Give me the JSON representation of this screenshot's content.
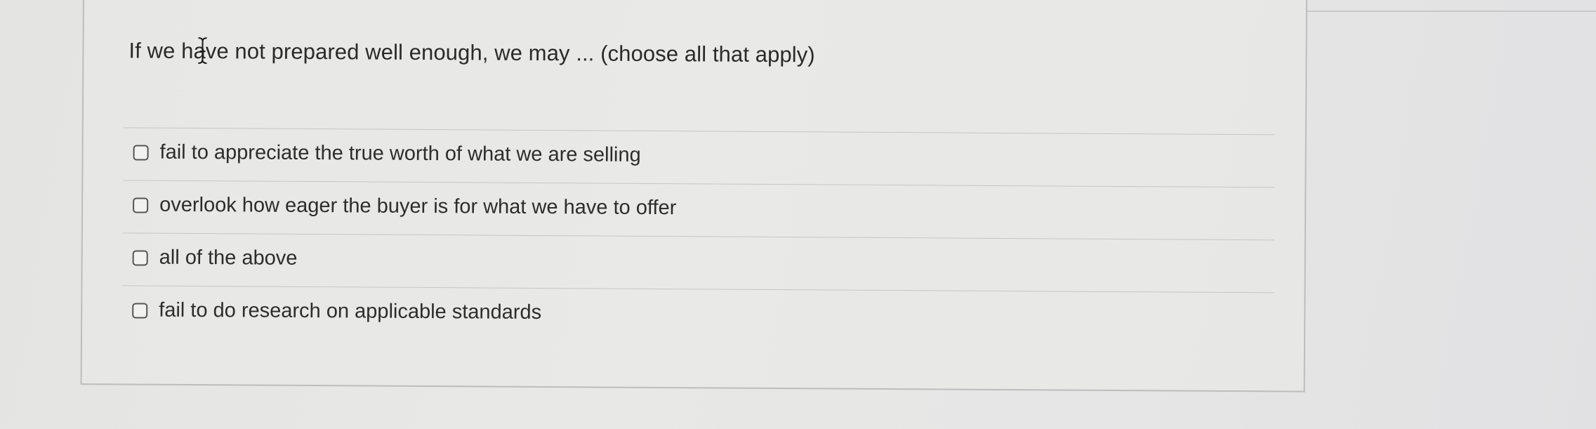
{
  "question": {
    "text": "If we have not prepared well enough, we may ... (choose all that apply)"
  },
  "options": [
    {
      "label": "fail to appreciate the true worth of what we are selling",
      "checked": false
    },
    {
      "label": "overlook how eager the buyer is for what we have to offer",
      "checked": false
    },
    {
      "label": "all of the above",
      "checked": false
    },
    {
      "label": "fail to do research on applicable standards",
      "checked": false
    }
  ],
  "icons": {
    "cursor": "text-cursor-icon"
  },
  "colors": {
    "text": "#2a2a2a",
    "border": "#bdbdbd",
    "checkbox_border": "#555555"
  }
}
